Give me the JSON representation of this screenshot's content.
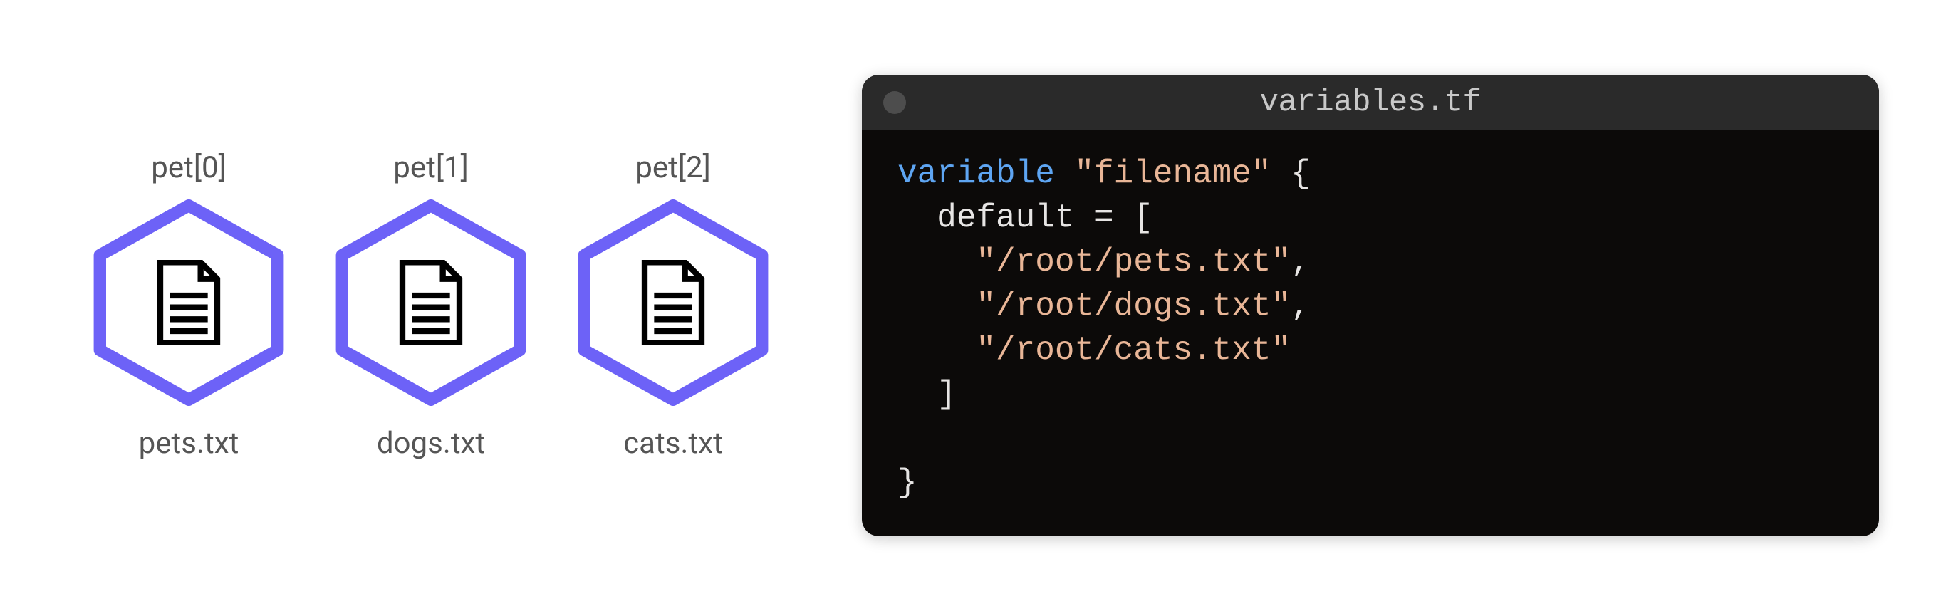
{
  "resources": [
    {
      "index_label": "pet[0]",
      "filename": "pets.txt"
    },
    {
      "index_label": "pet[1]",
      "filename": "dogs.txt"
    },
    {
      "index_label": "pet[2]",
      "filename": "cats.txt"
    }
  ],
  "editor": {
    "filename": "variables.tf",
    "code": {
      "keyword": "variable",
      "block_name": "\"filename\"",
      "brace_open": "{",
      "prop": "default",
      "eq": " = ",
      "bracket_open": "[",
      "values": [
        "\"/root/pets.txt\"",
        "\"/root/dogs.txt\"",
        "\"/root/cats.txt\""
      ],
      "bracket_close": "]",
      "brace_close": "}",
      "comma": ","
    }
  },
  "colors": {
    "hex_border": "#6d62f7",
    "hex_fill": "#ffffff",
    "editor_bg": "#0c0a09",
    "editor_titlebar": "#2a2a2a"
  }
}
